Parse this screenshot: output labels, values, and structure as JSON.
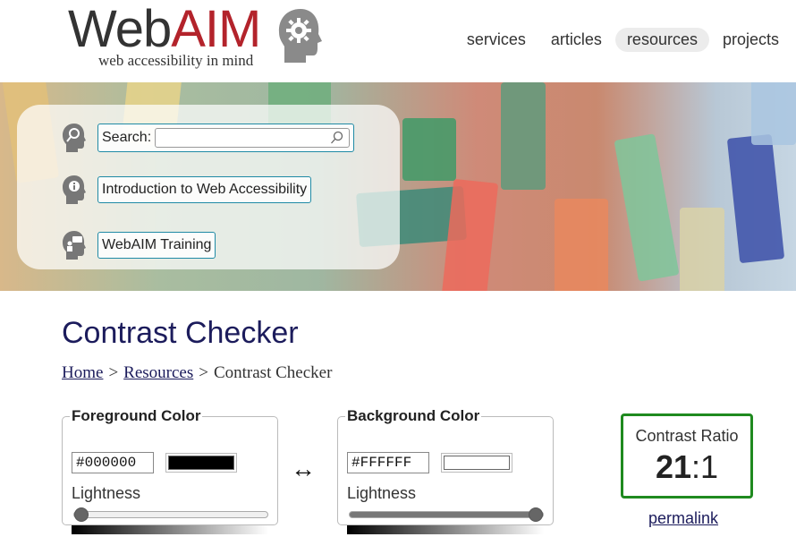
{
  "header": {
    "logo": {
      "word_web": "Web",
      "word_aim": "AIM",
      "tagline": "web accessibility in mind"
    },
    "nav": [
      {
        "label": "services",
        "active": false
      },
      {
        "label": "articles",
        "active": false
      },
      {
        "label": "resources",
        "active": true
      },
      {
        "label": "projects",
        "active": false
      }
    ]
  },
  "quicklinks": {
    "search_label": "Search:",
    "search_value": "",
    "intro_link": "Introduction to Web Accessibility",
    "training_link": "WebAIM Training"
  },
  "main": {
    "title": "Contrast Checker",
    "breadcrumb": {
      "home": "Home",
      "sep1": ">",
      "resources": "Resources",
      "sep2": ">",
      "current": "Contrast Checker"
    }
  },
  "foreground": {
    "legend": "Foreground Color",
    "hex": "#000000",
    "swatch_color": "#000000",
    "lightness_label": "Lightness",
    "lightness": 0
  },
  "background": {
    "legend": "Background Color",
    "hex": "#FFFFFF",
    "swatch_color": "#FFFFFF",
    "lightness_label": "Lightness",
    "lightness": 1
  },
  "swap_symbol": "↔",
  "result": {
    "label": "Contrast Ratio",
    "ratio_main": "21",
    "ratio_sep": ":",
    "ratio_tail": "1",
    "accent_color": "#1f8a1f"
  },
  "permalink": "permalink",
  "icons": [
    "gear-head-icon",
    "search-icon",
    "info-icon",
    "training-icon",
    "magnifier-icon",
    "swap-arrows-icon"
  ]
}
